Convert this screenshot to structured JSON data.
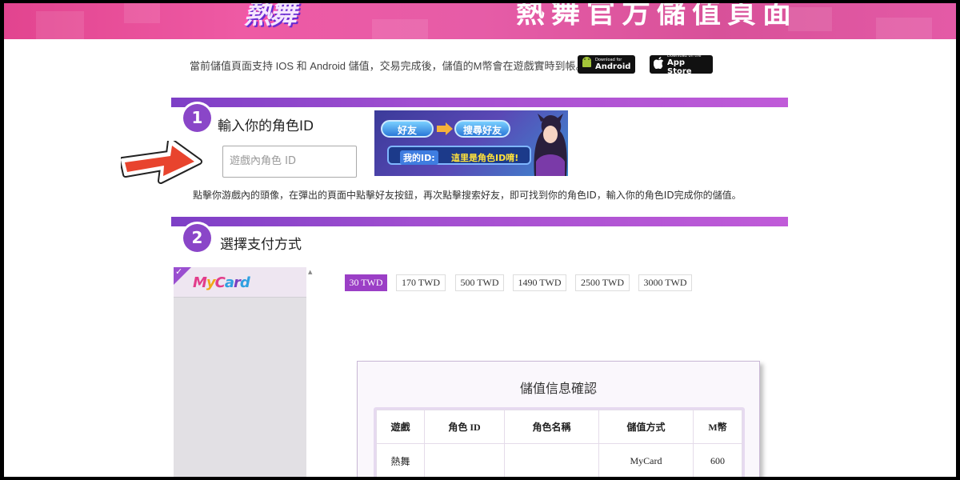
{
  "banner": {
    "logo_text": "熱舞",
    "title": "熱舞官方儲值頁面"
  },
  "intro": {
    "text": "當前儲值頁面支持 IOS 和 Android 儲值，交易完成後，儲值的M幣會在遊戲實時到帳。",
    "android": {
      "small": "Download for",
      "big": "Android"
    },
    "appstore": {
      "small": "Download on the",
      "big": "App Store"
    }
  },
  "step1": {
    "number": "1",
    "title": "輸入你的角色ID",
    "input_placeholder": "遊戲內角色 ID",
    "hint": "點擊你游戲內的頭像，在彈出的頁面中點擊好友按鈕，再次點擊搜索好友，即可找到你的角色ID，輸入你的角色ID完成你的儲值。",
    "guide": {
      "friend": "好友",
      "search_friend": "搜尋好友",
      "my_id_label": "我的ID:",
      "my_id_text": "這里是角色ID唷!"
    }
  },
  "step2": {
    "number": "2",
    "title": "選擇支付方式",
    "methods": [
      {
        "name": "MyCard",
        "selected": true
      }
    ],
    "amounts": [
      {
        "label": "30 TWD",
        "selected": true
      },
      {
        "label": "170 TWD",
        "selected": false
      },
      {
        "label": "500 TWD",
        "selected": false
      },
      {
        "label": "1490 TWD",
        "selected": false
      },
      {
        "label": "2500 TWD",
        "selected": false
      },
      {
        "label": "3000 TWD",
        "selected": false
      }
    ]
  },
  "confirm": {
    "title": "儲值信息確認",
    "headers": [
      "遊戲",
      "角色 ID",
      "角色名稱",
      "儲值方式",
      "M幣"
    ],
    "row": [
      "熱舞",
      "",
      "",
      "MyCard",
      "600"
    ]
  },
  "colors": {
    "accent": "#9b3fc6",
    "banner": "#e65ca7",
    "arrow": "#e8442e"
  }
}
